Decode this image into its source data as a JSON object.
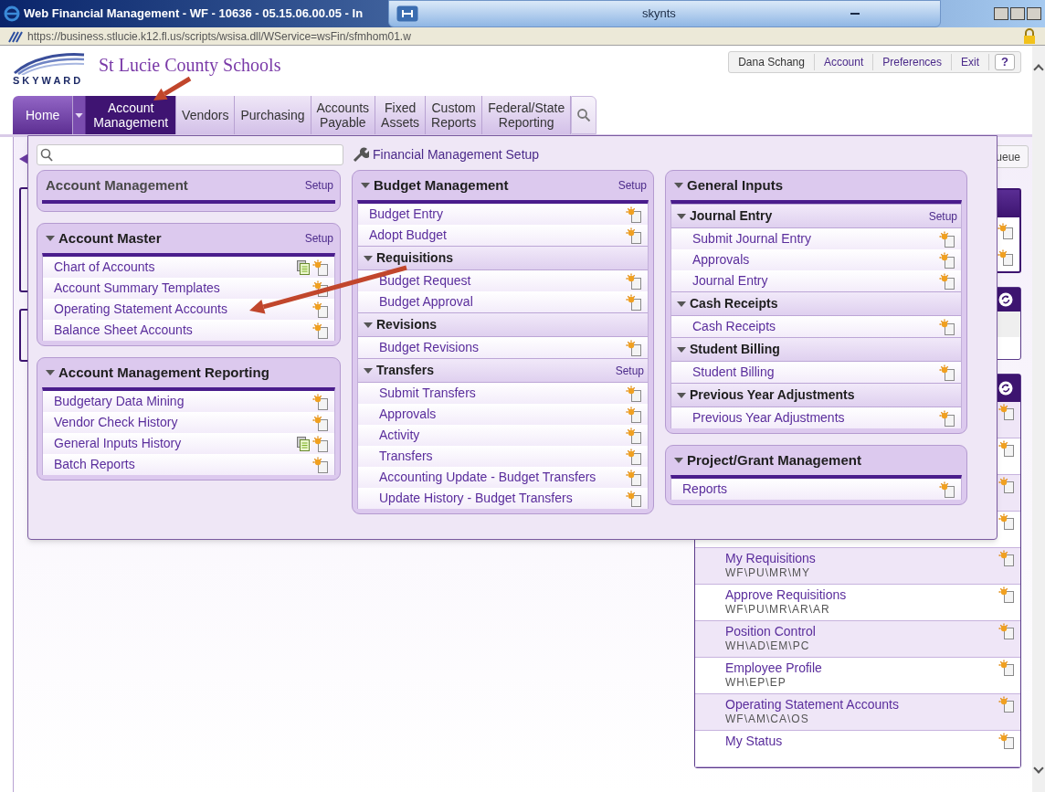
{
  "window": {
    "title": "Web Financial Management - WF - 10636 - 05.15.06.00.05 - In",
    "remote_session": "skynts"
  },
  "address_bar": {
    "url": "https://business.stlucie.k12.fl.us/scripts/wsisa.dll/WService=wsFin/sfmhom01.w"
  },
  "header": {
    "logo_text": "SKYWARD",
    "school_name": "St Lucie County Schools",
    "user_name": "Dana Schang",
    "links": [
      "Account",
      "Preferences",
      "Exit"
    ],
    "help": "?"
  },
  "nav": {
    "tabs": [
      {
        "label": "Home",
        "kind": "home",
        "selected": false
      },
      {
        "label": "Account Management",
        "kind": "tab",
        "selected": true
      },
      {
        "label": "Vendors",
        "kind": "tab",
        "selected": false
      },
      {
        "label": "Purchasing",
        "kind": "tab",
        "selected": false
      },
      {
        "label": "Accounts Payable",
        "kind": "tab",
        "selected": false
      },
      {
        "label": "Fixed Assets",
        "kind": "tab",
        "selected": false
      },
      {
        "label": "Custom Reports",
        "kind": "tab",
        "selected": false
      },
      {
        "label": "Federal/State Reporting",
        "kind": "tab",
        "selected": false
      }
    ]
  },
  "menu": {
    "setup_link": "Financial Management Setup",
    "columns": [
      [
        {
          "title": "Account Management",
          "expandable": false,
          "setup": "Setup"
        },
        {
          "title": "Account Master",
          "expandable": true,
          "setup": "Setup",
          "sections": [
            {
              "items": [
                {
                  "label": "Chart of Accounts",
                  "report_icon": true
                },
                {
                  "label": "Account Summary Templates",
                  "report_icon": false
                },
                {
                  "label": "Operating Statement Accounts",
                  "report_icon": false
                },
                {
                  "label": "Balance Sheet Accounts",
                  "report_icon": false
                }
              ]
            }
          ]
        },
        {
          "title": "Account Management Reporting",
          "expandable": true,
          "sections": [
            {
              "items": [
                {
                  "label": "Budgetary Data Mining",
                  "report_icon": false
                },
                {
                  "label": "Vendor Check History",
                  "report_icon": false
                },
                {
                  "label": "General Inputs History",
                  "report_icon": true
                },
                {
                  "label": "Batch Reports",
                  "report_icon": false
                }
              ]
            }
          ]
        }
      ],
      [
        {
          "title": "Budget Management",
          "expandable": true,
          "setup": "Setup",
          "sections": [
            {
              "items": [
                {
                  "label": "Budget Entry",
                  "report_icon": false
                },
                {
                  "label": "Adopt Budget",
                  "report_icon": false
                }
              ]
            },
            {
              "title": "Requisitions",
              "items": [
                {
                  "label": "Budget Request",
                  "report_icon": false
                },
                {
                  "label": "Budget Approval",
                  "report_icon": false
                }
              ]
            },
            {
              "title": "Revisions",
              "items": [
                {
                  "label": "Budget Revisions",
                  "report_icon": false
                }
              ]
            },
            {
              "title": "Transfers",
              "setup": "Setup",
              "items": [
                {
                  "label": "Submit Transfers",
                  "report_icon": false
                },
                {
                  "label": "Approvals",
                  "report_icon": false
                },
                {
                  "label": "Activity",
                  "report_icon": false
                },
                {
                  "label": "Transfers",
                  "report_icon": false
                },
                {
                  "label": "Accounting Update - Budget Transfers",
                  "report_icon": false
                },
                {
                  "label": "Update History - Budget Transfers",
                  "report_icon": false
                }
              ]
            }
          ]
        }
      ],
      [
        {
          "title": "General Inputs",
          "expandable": true,
          "sections": [
            {
              "title": "Journal Entry",
              "setup": "Setup",
              "items": [
                {
                  "label": "Submit Journal Entry",
                  "report_icon": false
                },
                {
                  "label": "Approvals",
                  "report_icon": false
                },
                {
                  "label": "Journal Entry",
                  "report_icon": false
                }
              ]
            },
            {
              "title": "Cash Receipts",
              "items": [
                {
                  "label": "Cash Receipts",
                  "report_icon": false
                }
              ]
            },
            {
              "title": "Student Billing",
              "items": [
                {
                  "label": "Student Billing",
                  "report_icon": false
                }
              ]
            },
            {
              "title": "Previous Year Adjustments",
              "items": [
                {
                  "label": "Previous Year Adjustments",
                  "report_icon": false
                }
              ]
            }
          ]
        },
        {
          "title": "Project/Grant Management",
          "expandable": true,
          "sections": [
            {
              "items": [
                {
                  "label": "Reports",
                  "report_icon": false
                }
              ]
            }
          ]
        }
      ]
    ]
  },
  "queue_button": "ueue",
  "favorites": {
    "items": [
      {
        "label": "My Requisitions",
        "path": "WF\\PU\\MR\\MY"
      },
      {
        "label": "Approve Requisitions",
        "path": "WF\\PU\\MR\\AR\\AR"
      },
      {
        "label": "Position Control",
        "path": "WH\\AD\\EM\\PC"
      },
      {
        "label": "Employee Profile",
        "path": "WH\\EP\\EP"
      },
      {
        "label": "Operating Statement Accounts",
        "path": "WF\\AM\\CA\\OS"
      },
      {
        "label": "My Status"
      }
    ]
  }
}
